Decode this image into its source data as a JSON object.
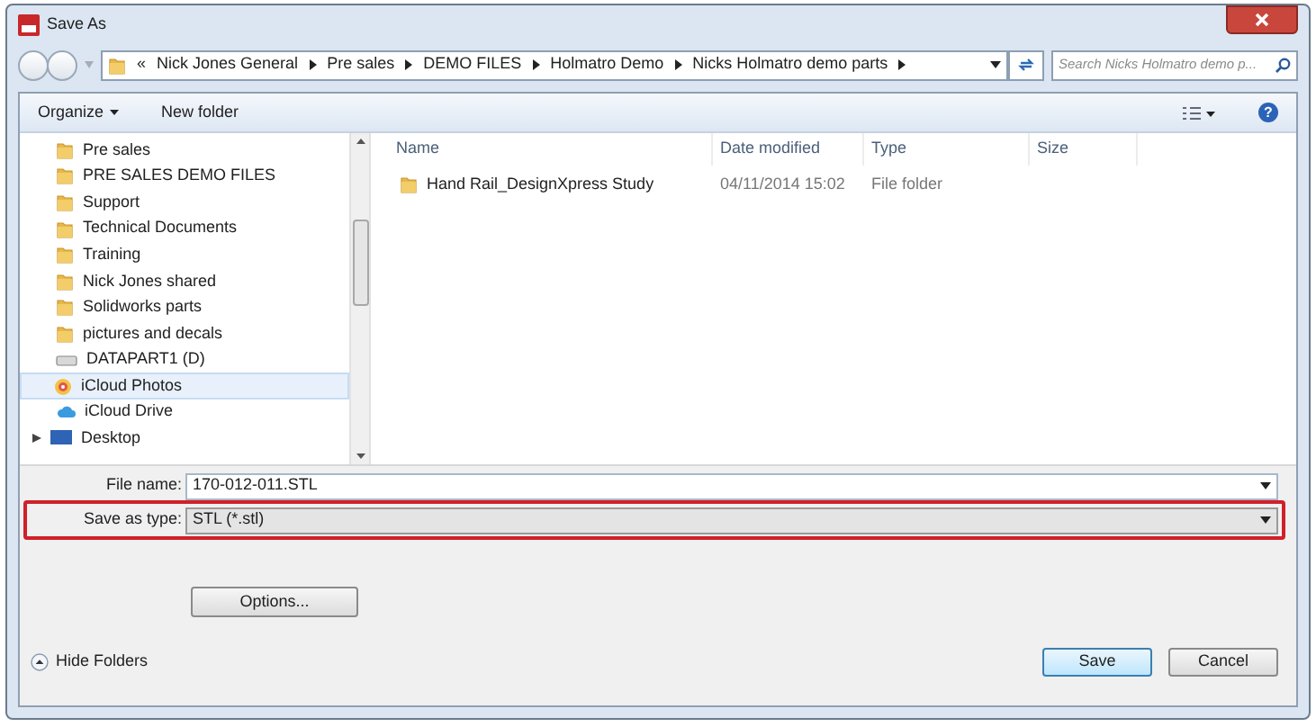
{
  "window": {
    "title": "Save As"
  },
  "address_bar": {
    "overflow": "«",
    "crumbs": [
      "Nick Jones General",
      "Pre sales",
      "DEMO FILES",
      "Holmatro Demo",
      "Nicks Holmatro demo parts"
    ]
  },
  "search": {
    "placeholder": "Search Nicks Holmatro demo p..."
  },
  "toolbar": {
    "organize": "Organize",
    "new_folder": "New folder",
    "help": "?"
  },
  "sidebar": {
    "items": [
      {
        "label": "Pre sales",
        "kind": "folder",
        "selected": false
      },
      {
        "label": "PRE SALES DEMO FILES",
        "kind": "folder",
        "selected": false
      },
      {
        "label": "Support",
        "kind": "folder",
        "selected": false
      },
      {
        "label": "Technical Documents",
        "kind": "folder",
        "selected": false
      },
      {
        "label": "Training",
        "kind": "folder",
        "selected": false
      },
      {
        "label": "Nick Jones shared",
        "kind": "folder",
        "selected": false
      },
      {
        "label": "Solidworks parts",
        "kind": "folder",
        "selected": false
      },
      {
        "label": "pictures and decals",
        "kind": "folder",
        "selected": false
      },
      {
        "label": "DATAPART1 (D)",
        "kind": "drive",
        "selected": false
      },
      {
        "label": "iCloud Photos",
        "kind": "photos",
        "selected": true
      },
      {
        "label": "iCloud Drive",
        "kind": "cloud",
        "selected": false
      },
      {
        "label": "Desktop",
        "kind": "desktop",
        "selected": false
      }
    ]
  },
  "table": {
    "columns": [
      "Name",
      "Date modified",
      "Type",
      "Size"
    ],
    "rows": [
      {
        "name": "Hand Rail_DesignXpress Study",
        "date": "04/11/2014 15:02",
        "type": "File folder"
      }
    ]
  },
  "file_name": {
    "label": "File name:",
    "value": "170-012-011.STL"
  },
  "save_as_type": {
    "label": "Save as type:",
    "value": "STL (*.stl)",
    "highlighted": true
  },
  "options_button": "Options...",
  "hide_folders": "Hide Folders",
  "buttons": [
    "Save",
    "Cancel"
  ]
}
